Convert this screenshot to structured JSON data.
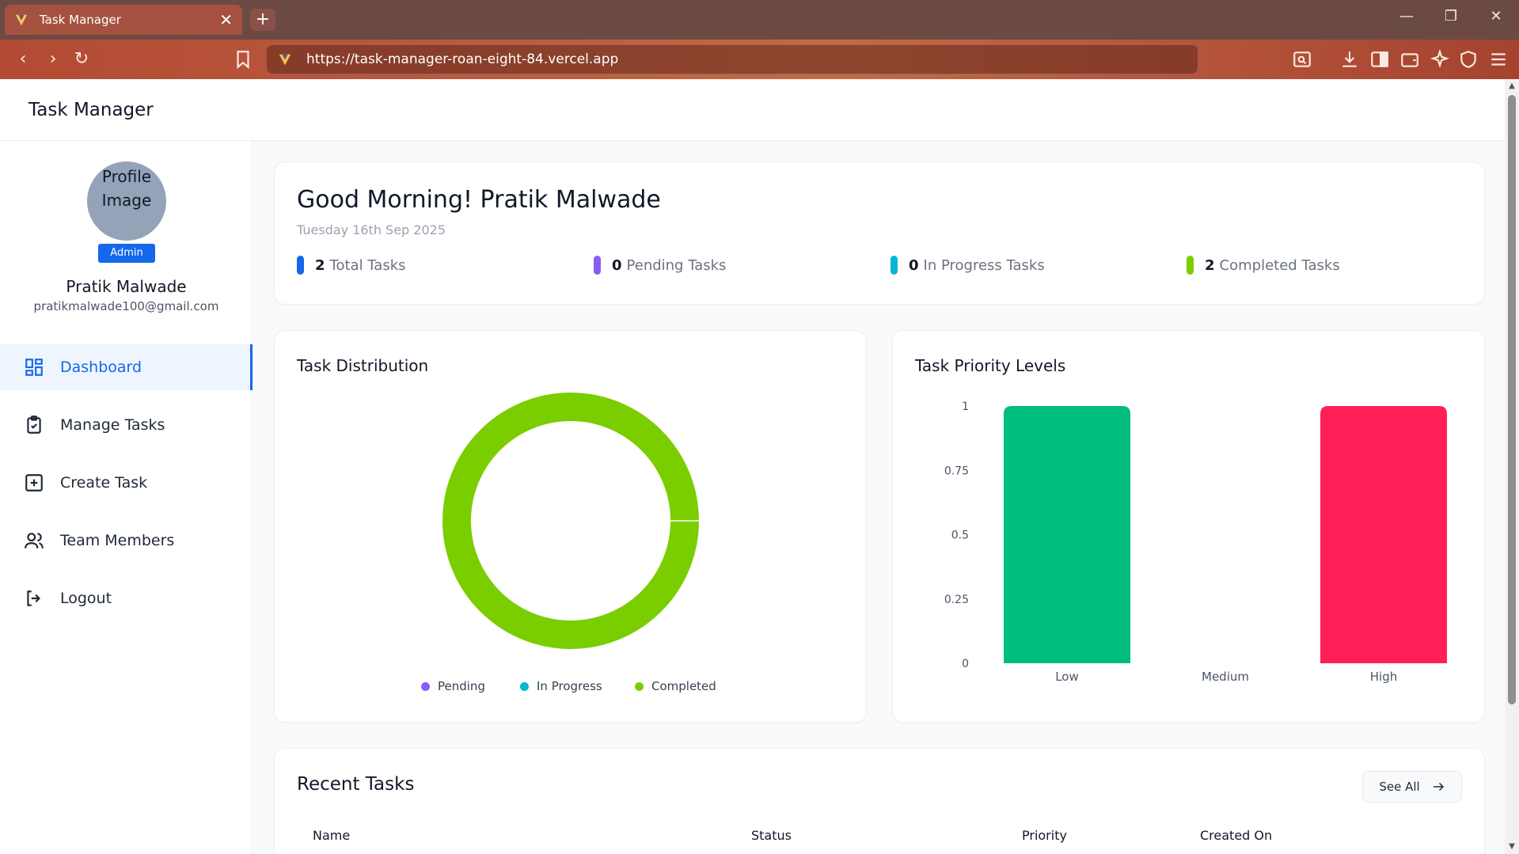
{
  "browser": {
    "tab_title": "Task Manager",
    "tab_close": "✕",
    "new_tab": "+",
    "url": "https://task-manager-roan-eight-84.vercel.app"
  },
  "app": {
    "title": "Task Manager"
  },
  "profile": {
    "image_alt": "Profile Image",
    "role": "Admin",
    "name": "Pratik Malwade",
    "email": "pratikmalwade100@gmail.com"
  },
  "menu": [
    {
      "label": "Dashboard",
      "icon": "dashboard-icon",
      "active": true
    },
    {
      "label": "Manage Tasks",
      "icon": "clipboard-check-icon"
    },
    {
      "label": "Create Task",
      "icon": "plus-square-icon"
    },
    {
      "label": "Team Members",
      "icon": "users-icon"
    },
    {
      "label": "Logout",
      "icon": "logout-icon"
    }
  ],
  "greeting": {
    "title": "Good Morning! Pratik Malwade",
    "date": "Tuesday 16th Sep 2025"
  },
  "stats": [
    {
      "value": "2",
      "label": "Total Tasks",
      "color": "#1368ec"
    },
    {
      "value": "0",
      "label": "Pending Tasks",
      "color": "#8b5cf6"
    },
    {
      "value": "0",
      "label": "In Progress Tasks",
      "color": "#06b6d4"
    },
    {
      "value": "2",
      "label": "Completed Tasks",
      "color": "#7ace00"
    }
  ],
  "distribution": {
    "title": "Task Distribution",
    "legend": [
      {
        "label": "Pending",
        "color": "#8b5cf6"
      },
      {
        "label": "In Progress",
        "color": "#06b6d4"
      },
      {
        "label": "Completed",
        "color": "#7ace00"
      }
    ]
  },
  "priority": {
    "title": "Task Priority Levels"
  },
  "recent": {
    "title": "Recent Tasks",
    "see_all": "See All",
    "columns": [
      "Name",
      "Status",
      "Priority",
      "Created On"
    ]
  },
  "chart_data": [
    {
      "type": "pie",
      "title": "Task Distribution",
      "categories": [
        "Pending",
        "In Progress",
        "Completed"
      ],
      "values": [
        0,
        0,
        2
      ],
      "colors": [
        "#8b5cf6",
        "#06b6d4",
        "#7ace00"
      ],
      "legend": "bottom"
    },
    {
      "type": "bar",
      "title": "Task Priority Levels",
      "categories": [
        "Low",
        "Medium",
        "High"
      ],
      "values": [
        1,
        0,
        1
      ],
      "colors": [
        "#00bc7d",
        "#f59e0b",
        "#ff1f57"
      ],
      "ylim": [
        0,
        1
      ],
      "yticks": [
        "0",
        "0.25",
        "0.5",
        "0.75",
        "1"
      ],
      "grid": false
    }
  ]
}
